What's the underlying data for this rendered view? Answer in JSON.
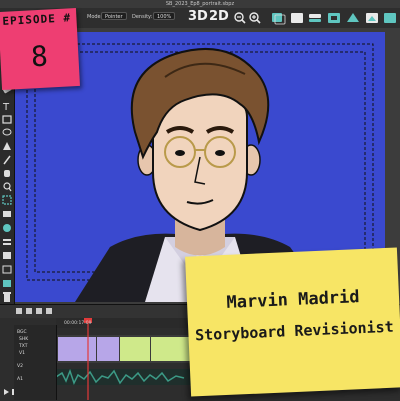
{
  "window": {
    "title": "SB_2023_Ep8_portrait.sbpz"
  },
  "toolbar": {
    "mode_label": "Mode:",
    "mode_value": "Pointer",
    "density_label": "Density:",
    "density_value": "100%",
    "toggle_3d": "3D",
    "toggle_2d": "2D"
  },
  "episode": {
    "label": "EPISODE #",
    "number": "8"
  },
  "card": {
    "name": "Marvin Madrid",
    "role": "Storyboard Revisionist"
  },
  "timeline": {
    "timecode": "00:00:17:09",
    "tracks": [
      "BGC",
      "SHK",
      "TXT",
      "V1",
      "V2",
      "A1"
    ]
  },
  "colors": {
    "canvas_bg": "#3a49cf",
    "episode_note": "#ee3e72",
    "name_note": "#f7e565",
    "clip_purple": "#b7a6e8",
    "clip_green": "#cfe98a",
    "playhead": "#e23a3a",
    "audio_wave": "#3c9a86"
  }
}
